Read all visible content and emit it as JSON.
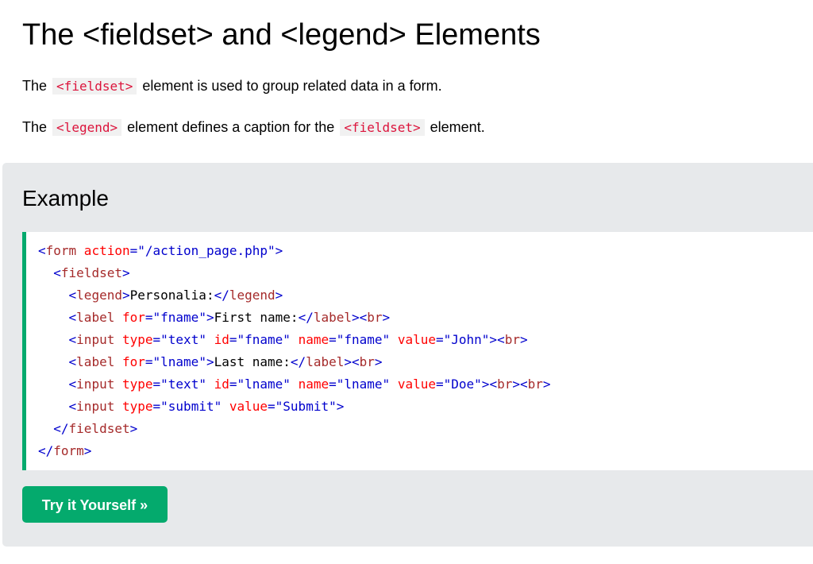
{
  "page": {
    "title": "The <fieldset> and <legend> Elements"
  },
  "intro": {
    "p1": {
      "before": "The",
      "code": "<fieldset>",
      "after": "element is used to group related data in a form."
    },
    "p2": {
      "before": "The",
      "code1": "<legend>",
      "middle": "element defines a caption for the",
      "code2": "<fieldset>",
      "after": "element."
    }
  },
  "example": {
    "heading": "Example",
    "code_lines": [
      [
        [
          "tag",
          "<"
        ],
        [
          "name",
          "form"
        ],
        [
          "attr",
          " action"
        ],
        [
          "tag",
          "="
        ],
        [
          "val",
          "\"/action_page.php\""
        ],
        [
          "tag",
          ">"
        ]
      ],
      [
        [
          "text",
          "  "
        ],
        [
          "tag",
          "<"
        ],
        [
          "name",
          "fieldset"
        ],
        [
          "tag",
          ">"
        ]
      ],
      [
        [
          "text",
          "    "
        ],
        [
          "tag",
          "<"
        ],
        [
          "name",
          "legend"
        ],
        [
          "tag",
          ">"
        ],
        [
          "text",
          "Personalia:"
        ],
        [
          "tag",
          "</"
        ],
        [
          "name",
          "legend"
        ],
        [
          "tag",
          ">"
        ]
      ],
      [
        [
          "text",
          "    "
        ],
        [
          "tag",
          "<"
        ],
        [
          "name",
          "label"
        ],
        [
          "attr",
          " for"
        ],
        [
          "tag",
          "="
        ],
        [
          "val",
          "\"fname\""
        ],
        [
          "tag",
          ">"
        ],
        [
          "text",
          "First name:"
        ],
        [
          "tag",
          "</"
        ],
        [
          "name",
          "label"
        ],
        [
          "tag",
          ">"
        ],
        [
          "tag",
          "<"
        ],
        [
          "name",
          "br"
        ],
        [
          "tag",
          ">"
        ]
      ],
      [
        [
          "text",
          "    "
        ],
        [
          "tag",
          "<"
        ],
        [
          "name",
          "input"
        ],
        [
          "attr",
          " type"
        ],
        [
          "tag",
          "="
        ],
        [
          "val",
          "\"text\""
        ],
        [
          "attr",
          " id"
        ],
        [
          "tag",
          "="
        ],
        [
          "val",
          "\"fname\""
        ],
        [
          "attr",
          " name"
        ],
        [
          "tag",
          "="
        ],
        [
          "val",
          "\"fname\""
        ],
        [
          "attr",
          " value"
        ],
        [
          "tag",
          "="
        ],
        [
          "val",
          "\"John\""
        ],
        [
          "tag",
          ">"
        ],
        [
          "tag",
          "<"
        ],
        [
          "name",
          "br"
        ],
        [
          "tag",
          ">"
        ]
      ],
      [
        [
          "text",
          "    "
        ],
        [
          "tag",
          "<"
        ],
        [
          "name",
          "label"
        ],
        [
          "attr",
          " for"
        ],
        [
          "tag",
          "="
        ],
        [
          "val",
          "\"lname\""
        ],
        [
          "tag",
          ">"
        ],
        [
          "text",
          "Last name:"
        ],
        [
          "tag",
          "</"
        ],
        [
          "name",
          "label"
        ],
        [
          "tag",
          ">"
        ],
        [
          "tag",
          "<"
        ],
        [
          "name",
          "br"
        ],
        [
          "tag",
          ">"
        ]
      ],
      [
        [
          "text",
          "    "
        ],
        [
          "tag",
          "<"
        ],
        [
          "name",
          "input"
        ],
        [
          "attr",
          " type"
        ],
        [
          "tag",
          "="
        ],
        [
          "val",
          "\"text\""
        ],
        [
          "attr",
          " id"
        ],
        [
          "tag",
          "="
        ],
        [
          "val",
          "\"lname\""
        ],
        [
          "attr",
          " name"
        ],
        [
          "tag",
          "="
        ],
        [
          "val",
          "\"lname\""
        ],
        [
          "attr",
          " value"
        ],
        [
          "tag",
          "="
        ],
        [
          "val",
          "\"Doe\""
        ],
        [
          "tag",
          ">"
        ],
        [
          "tag",
          "<"
        ],
        [
          "name",
          "br"
        ],
        [
          "tag",
          ">"
        ],
        [
          "tag",
          "<"
        ],
        [
          "name",
          "br"
        ],
        [
          "tag",
          ">"
        ]
      ],
      [
        [
          "text",
          "    "
        ],
        [
          "tag",
          "<"
        ],
        [
          "name",
          "input"
        ],
        [
          "attr",
          " type"
        ],
        [
          "tag",
          "="
        ],
        [
          "val",
          "\"submit\""
        ],
        [
          "attr",
          " value"
        ],
        [
          "tag",
          "="
        ],
        [
          "val",
          "\"Submit\""
        ],
        [
          "tag",
          ">"
        ]
      ],
      [
        [
          "text",
          "  "
        ],
        [
          "tag",
          "</"
        ],
        [
          "name",
          "fieldset"
        ],
        [
          "tag",
          ">"
        ]
      ],
      [
        [
          "tag",
          "</"
        ],
        [
          "name",
          "form"
        ],
        [
          "tag",
          ">"
        ]
      ]
    ],
    "try_button_label": "Try it Yourself »"
  },
  "colors": {
    "accent_green": "#04aa6d",
    "panel_gray": "#e7e9eb",
    "inline_code_red": "#dc143c",
    "syntax_tag": "#0000cd",
    "syntax_element_name": "#a52a2a",
    "syntax_attribute": "#ff0000",
    "syntax_value": "#0000cd"
  }
}
